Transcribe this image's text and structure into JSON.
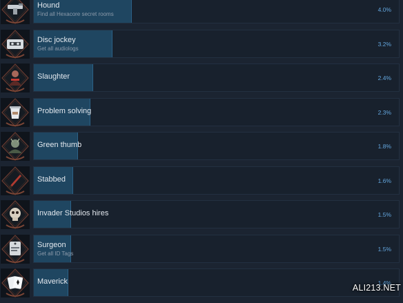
{
  "achievements": [
    {
      "title": "Hound",
      "description": "Find all Hexacore secret rooms",
      "percent_label": "4.0%",
      "percent": 4.0,
      "icon": "gun-icon"
    },
    {
      "title": "Disc jockey",
      "description": "Get all audiologs",
      "percent_label": "3.2%",
      "percent": 3.2,
      "icon": "cassette-icon"
    },
    {
      "title": "Slaughter",
      "description": "",
      "percent_label": "2.4%",
      "percent": 2.4,
      "icon": "soldier-icon"
    },
    {
      "title": "Problem solving",
      "description": "",
      "percent_label": "2.3%",
      "percent": 2.3,
      "icon": "cup-icon"
    },
    {
      "title": "Green thumb",
      "description": "",
      "percent_label": "1.8%",
      "percent": 1.8,
      "icon": "plant-creature-icon"
    },
    {
      "title": "Stabbed",
      "description": "",
      "percent_label": "1.6%",
      "percent": 1.6,
      "icon": "knife-icon"
    },
    {
      "title": "Invader Studios hires",
      "description": "",
      "percent_label": "1.5%",
      "percent": 1.5,
      "icon": "skull-icon"
    },
    {
      "title": "Surgeon",
      "description": "Get all ID Tags",
      "percent_label": "1.5%",
      "percent": 1.5,
      "icon": "id-tag-icon"
    },
    {
      "title": "Maverick",
      "description": "",
      "percent_label": "1.4%",
      "percent": 1.4,
      "icon": "playing-cards-icon"
    }
  ],
  "watermark": "ALI213.NET",
  "colors": {
    "background": "#1b2431",
    "progress_fill": "#1f4661",
    "percent_text": "#64a7df",
    "icon_accent": "#8a4a3a"
  }
}
